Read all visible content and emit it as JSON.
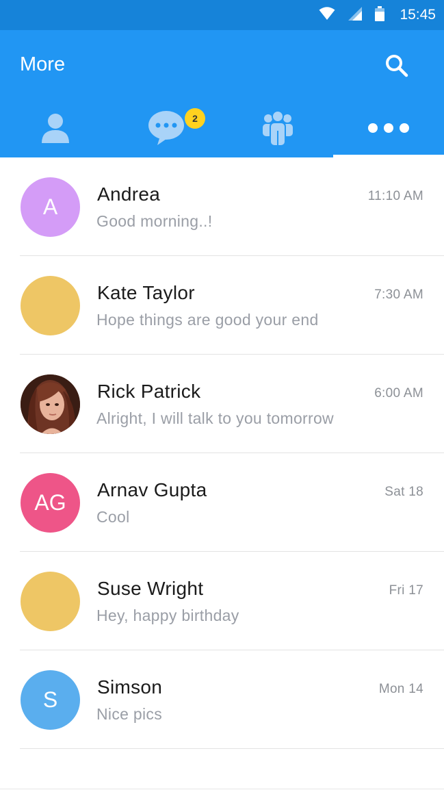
{
  "status_bar": {
    "time": "15:45",
    "icons": [
      "wifi-icon",
      "cellular-signal-icon",
      "battery-icon"
    ]
  },
  "header": {
    "title": "More",
    "search_icon": "search-icon",
    "color": "#2196f3"
  },
  "tabs": [
    {
      "icon": "contact-icon",
      "active": false
    },
    {
      "icon": "chat-bubble-icon",
      "active": false,
      "badge": "2"
    },
    {
      "icon": "group-icon",
      "active": false
    },
    {
      "icon": "more-dots-icon",
      "active": true
    }
  ],
  "conversations": [
    {
      "name": "Andrea",
      "message": "Good morning..!",
      "time": "11:10 AM",
      "avatar_text": "A",
      "avatar_color": "#d49cf7"
    },
    {
      "name": "Kate Taylor",
      "message": "Hope things are good your end",
      "time": "7:30 AM",
      "avatar_text": "",
      "avatar_color": "#eec665"
    },
    {
      "name": "Rick Patrick",
      "message": "Alright, I will talk to you tomorrow",
      "time": "6:00 AM",
      "avatar_text": "",
      "avatar_color": "#6b3a2a",
      "avatar_photo": true
    },
    {
      "name": "Arnav Gupta",
      "message": "Cool",
      "time": "Sat 18",
      "avatar_text": "AG",
      "avatar_color": "#ee5588"
    },
    {
      "name": "Suse Wright",
      "message": "Hey, happy birthday",
      "time": "Fri 17",
      "avatar_text": "",
      "avatar_color": "#eec665"
    },
    {
      "name": "Simson",
      "message": "Nice pics",
      "time": "Mon 14",
      "avatar_text": "S",
      "avatar_color": "#5aaeee"
    }
  ]
}
